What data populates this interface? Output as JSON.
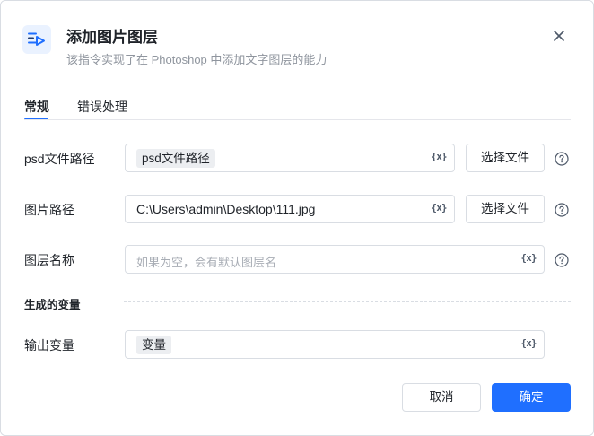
{
  "header": {
    "title": "添加图片图层",
    "subtitle": "该指令实现了在 Photoshop 中添加文字图层的能力",
    "icon": "layers-play-icon",
    "accent_color": "#1f6fff"
  },
  "tabs": [
    {
      "label": "常规",
      "active": true
    },
    {
      "label": "错误处理",
      "active": false
    }
  ],
  "form": {
    "psd_path": {
      "label": "psd文件路径",
      "chip": "psd文件路径",
      "button": "选择文件"
    },
    "image_path": {
      "label": "图片路径",
      "value": "C:\\Users\\admin\\Desktop\\111.jpg",
      "button": "选择文件"
    },
    "layer_name": {
      "label": "图层名称",
      "placeholder": "如果为空，会有默认图层名"
    },
    "variable_icon": "{x}"
  },
  "output": {
    "section_title": "生成的变量",
    "label": "输出变量",
    "chip": "变量"
  },
  "footer": {
    "cancel": "取消",
    "ok": "确定"
  }
}
